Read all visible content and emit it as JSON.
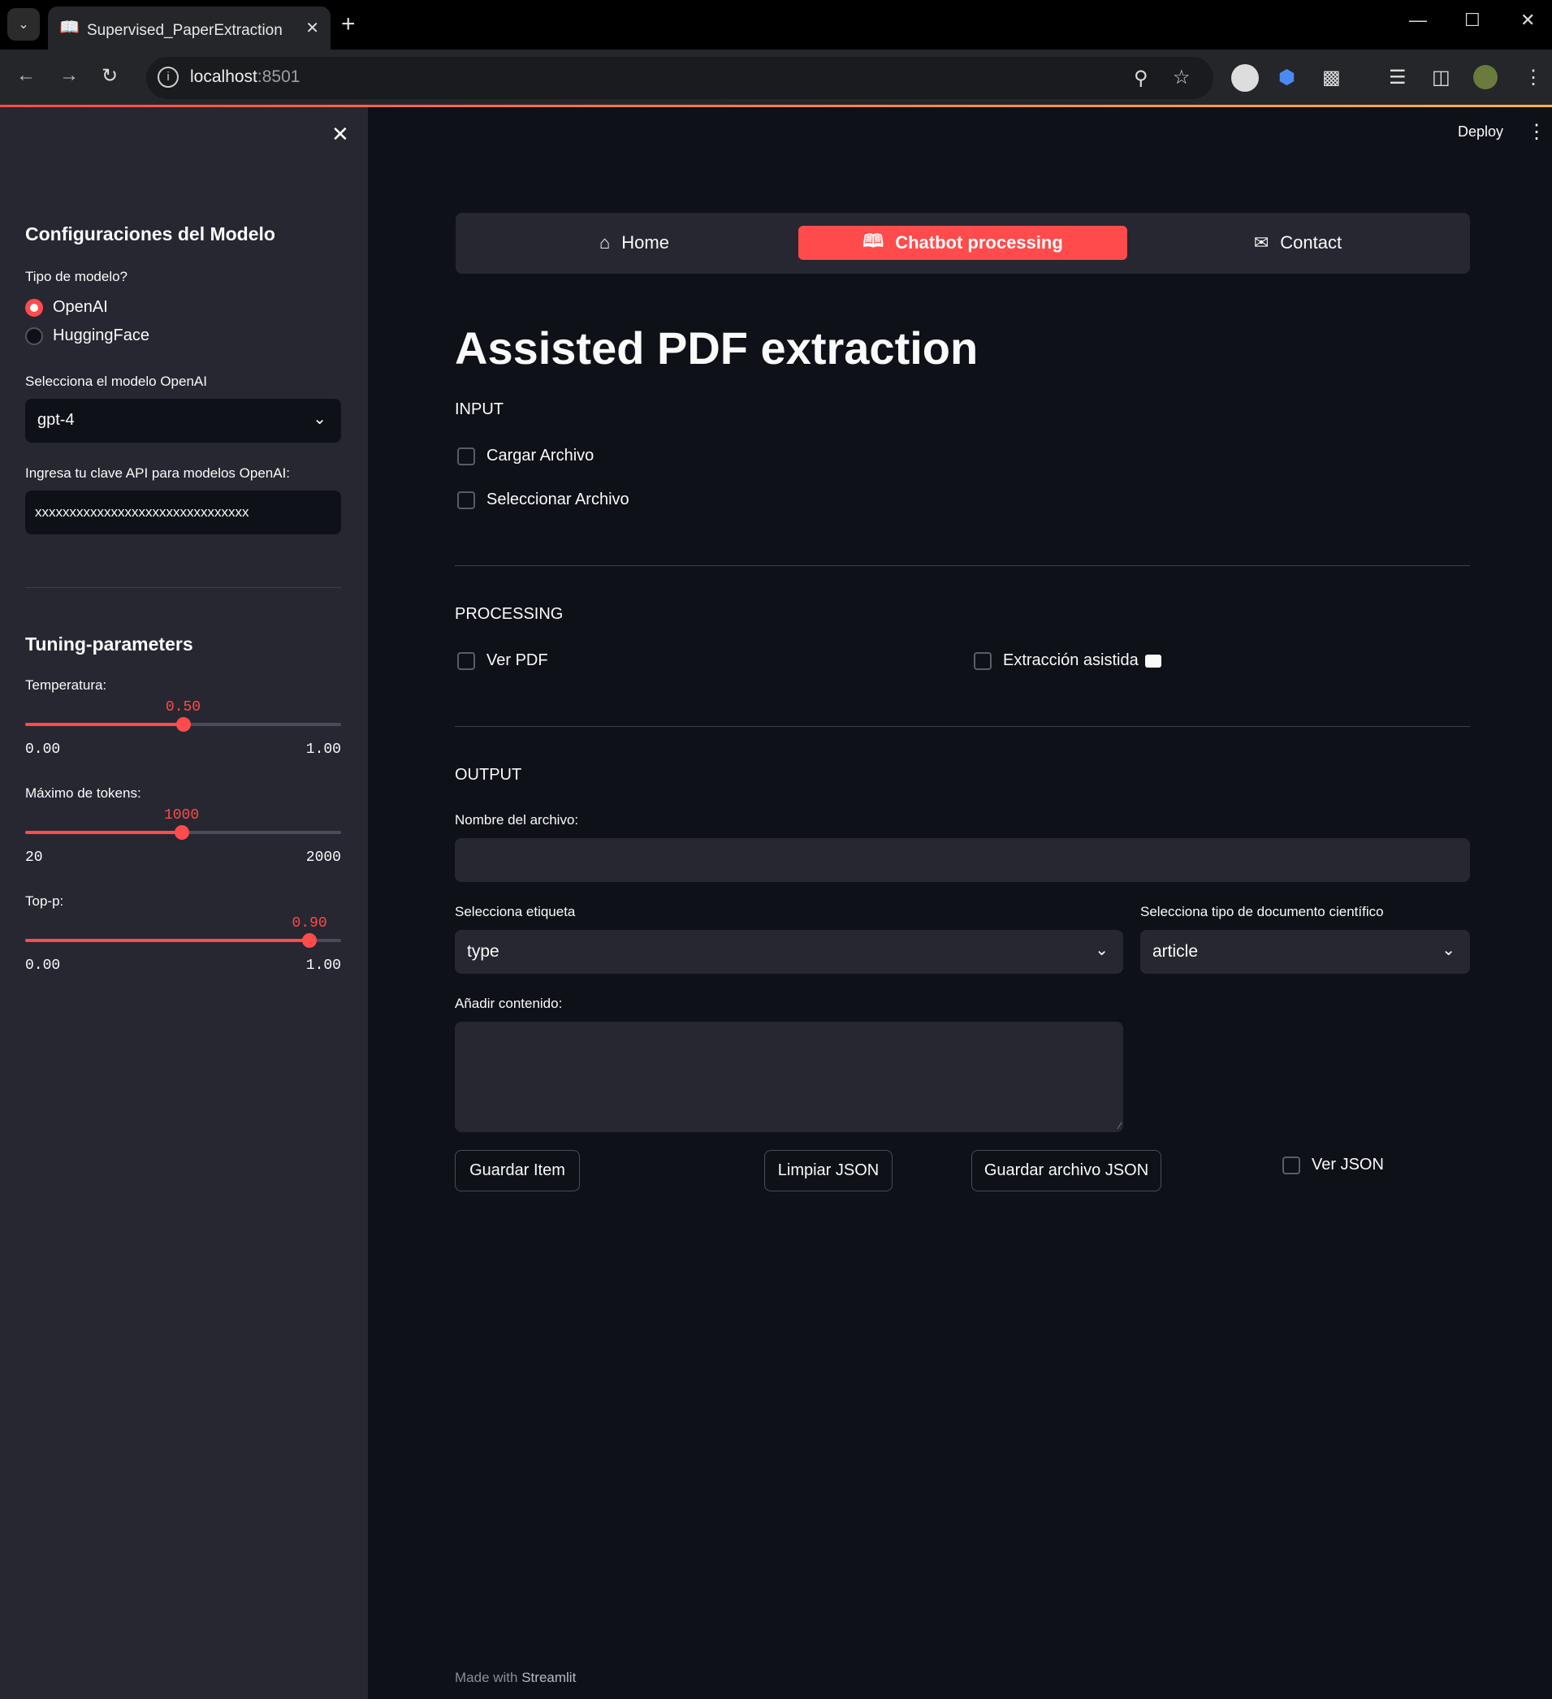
{
  "browser": {
    "tab_title": "Supervised_PaperExtraction",
    "url_host": "localhost",
    "url_port": ":8501",
    "tab_icon": "book-emoji"
  },
  "sidebar": {
    "section1_title": "Configuraciones del Modelo",
    "model_type_label": "Tipo de modelo?",
    "model_options": [
      "OpenAI",
      "HuggingFace"
    ],
    "model_selected": "OpenAI",
    "select_model_label": "Selecciona el modelo OpenAI",
    "select_model_value": "gpt-4",
    "api_key_label": "Ingresa tu clave API para modelos OpenAI:",
    "api_key_value": "xxxxxxxxxxxxxxxxxxxxxxxxxxxxxxx",
    "section2_title": "Tuning-parameters",
    "sliders": [
      {
        "label": "Temperatura:",
        "value": "0.50",
        "min": "0.00",
        "max": "1.00",
        "fraction": 0.5
      },
      {
        "label": "Máximo de tokens:",
        "value": "1000",
        "min": "20",
        "max": "2000",
        "fraction": 0.495
      },
      {
        "label": "Top-p:",
        "value": "0.90",
        "min": "0.00",
        "max": "1.00",
        "fraction": 0.9
      }
    ]
  },
  "header": {
    "deploy_label": "Deploy"
  },
  "nav": {
    "home": "Home",
    "chatbot": "Chatbot processing",
    "contact": "Contact",
    "active": "Chatbot processing"
  },
  "main": {
    "title": "Assisted PDF extraction",
    "input_header": "INPUT",
    "cargar_archivo": "Cargar Archivo",
    "seleccionar_archivo": "Seleccionar Archivo",
    "processing_header": "PROCESSING",
    "ver_pdf": "Ver PDF",
    "extraccion_asistida": "Extracción asistida",
    "output_header": "OUTPUT",
    "nombre_archivo_label": "Nombre del archivo:",
    "nombre_archivo_value": "",
    "etiqueta_label": "Selecciona etiqueta",
    "etiqueta_value": "type",
    "tipo_doc_label": "Selecciona tipo de documento científico",
    "tipo_doc_value": "article",
    "contenido_label": "Añadir contenido:",
    "contenido_value": "",
    "guardar_item": "Guardar Item",
    "limpiar_json": "Limpiar JSON",
    "guardar_archivo_json": "Guardar archivo JSON",
    "ver_json": "Ver JSON"
  },
  "footer": {
    "prefix": "Made with",
    "brand": "Streamlit"
  },
  "colors": {
    "accent": "#ff4b4b",
    "background": "#0e1117",
    "sidebar": "#262730"
  }
}
